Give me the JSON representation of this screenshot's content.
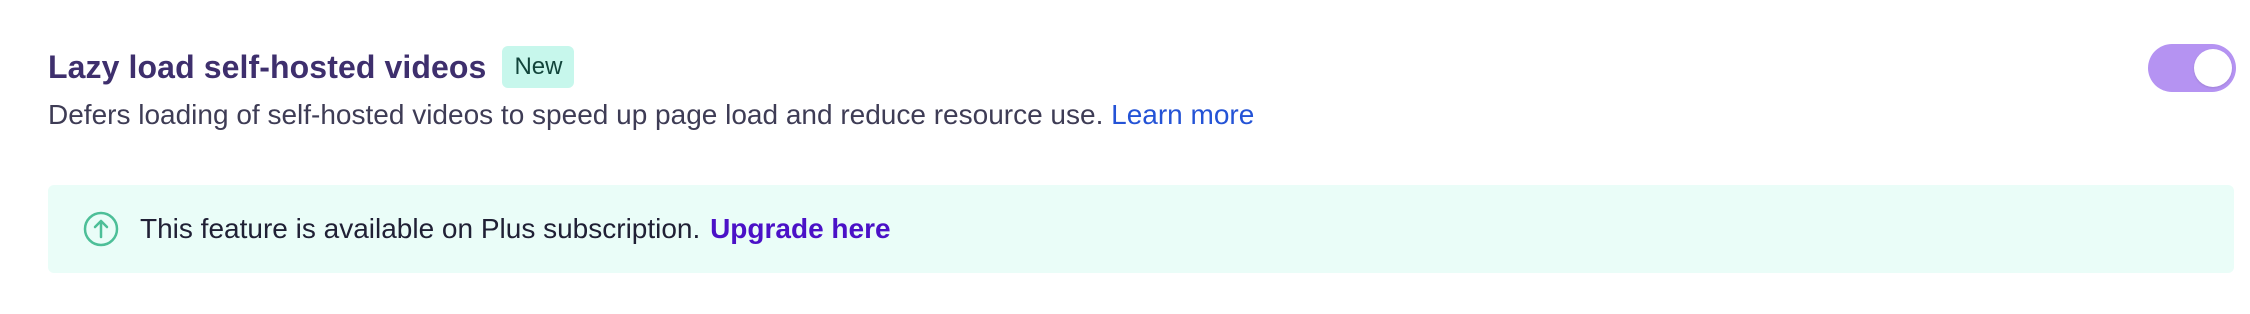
{
  "setting": {
    "title": "Lazy load self-hosted videos",
    "badge": "New",
    "description": "Defers loading of self-hosted videos to speed up page load and reduce resource use.",
    "learn_more": "Learn more",
    "toggle_enabled": true
  },
  "notice": {
    "icon": "arrow-up-circle-icon",
    "text": "This feature is available on Plus subscription.",
    "link_label": "Upgrade here"
  },
  "colors": {
    "title": "#3e2f6d",
    "badge_bg": "#c7f7ec",
    "link": "#2453d6",
    "toggle_on": "#b593f2",
    "notice_bg": "#eafdf8",
    "notice_icon": "#4dbf98",
    "upgrade_link": "#4b11c7"
  }
}
